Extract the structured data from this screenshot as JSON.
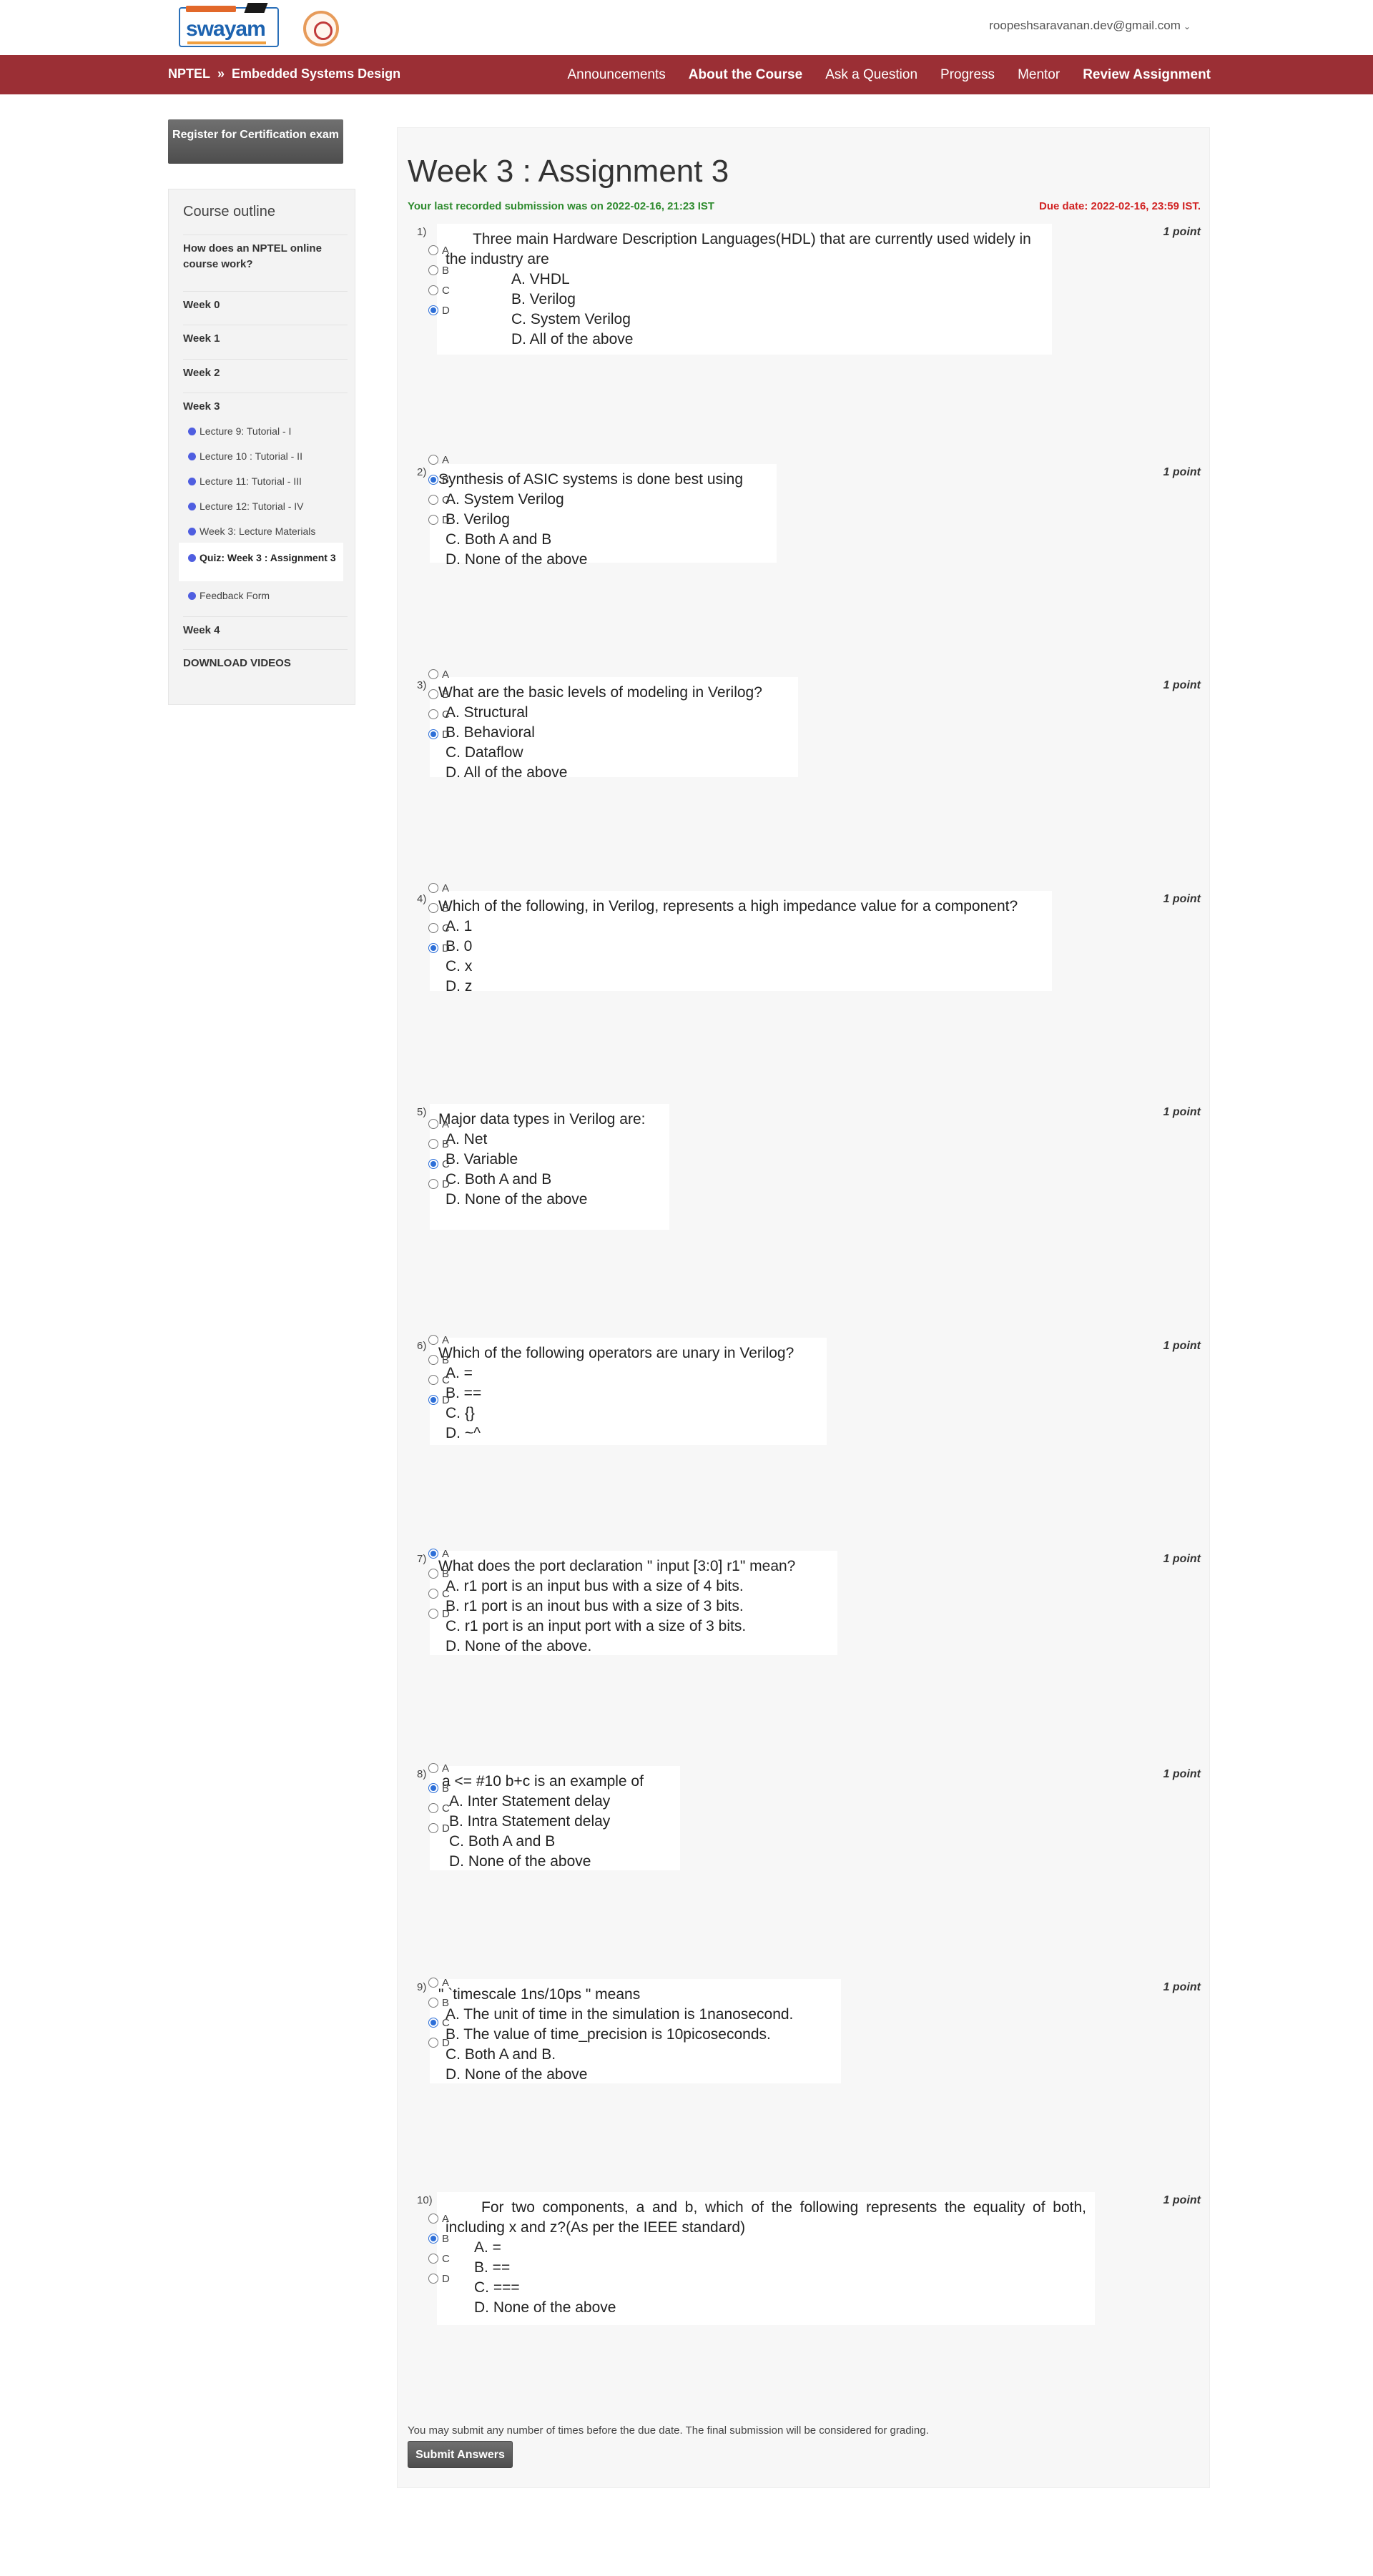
{
  "header": {
    "logo_text": "swayam",
    "user_email": "roopeshsaravanan.dev@gmail.com"
  },
  "nav": {
    "brand": "NPTEL",
    "separator": "»",
    "course": "Embedded Systems Design",
    "links": [
      "Announcements",
      "About the Course",
      "Ask a Question",
      "Progress",
      "Mentor",
      "Review Assignment"
    ]
  },
  "sidebar": {
    "register_button": "Register for Certification exam",
    "outline_title": "Course outline",
    "items": {
      "nptel": "How does an NPTEL online course work?",
      "week0": "Week 0",
      "week1": "Week 1",
      "week2": "Week 2",
      "week3": "Week 3",
      "l9": "Lecture 9: Tutorial - I",
      "l10": "Lecture 10 : Tutorial - II",
      "l11": "Lecture 11: Tutorial - III",
      "l12": "Lecture 12: Tutorial - IV",
      "w3mat": "Week 3: Lecture Materials",
      "quiz": "Quiz: Week 3 : Assignment 3",
      "feedback": "Feedback Form",
      "week4": "Week 4",
      "download": "DOWNLOAD VIDEOS"
    }
  },
  "assignment": {
    "title": "Week 3 : Assignment 3",
    "last_submission": "Your last recorded submission was on 2022-02-16, 21:23 IST",
    "due_date": "Due date: 2022-02-16, 23:59 IST.",
    "point_label": "1 point",
    "radio_labels": [
      "A",
      "B",
      "C",
      "D"
    ],
    "questions": [
      {
        "num": "1)",
        "stem": "Three main Hardware Description Languages(HDL) that are currently used widely in the industry are",
        "options": [
          "A.   VHDL",
          "B.   Verilog",
          "C.   System Verilog",
          "D.   All of the above"
        ],
        "selected": "D"
      },
      {
        "num": "2)",
        "stem": "Synthesis of ASIC systems is done best using",
        "options": [
          "A.   System Verilog",
          "B.   Verilog",
          "C.   Both A and B",
          "D.   None of the above"
        ],
        "selected": "B"
      },
      {
        "num": "3)",
        "stem": "What are the basic levels of modeling in Verilog?",
        "options": [
          "A.   Structural",
          "B.   Behavioral",
          "C.   Dataflow",
          "D.   All of the above"
        ],
        "selected": "D"
      },
      {
        "num": "4)",
        "stem": "Which of the following, in Verilog, represents a high impedance value for a component?",
        "options": [
          "A.   1",
          "B.   0",
          "C.   x",
          "D.   z"
        ],
        "selected": "D"
      },
      {
        "num": "5)",
        "stem": "Major data types in Verilog are:",
        "options": [
          "A.   Net",
          "B.   Variable",
          "C.   Both A and B",
          "D.   None of the above"
        ],
        "selected": "C"
      },
      {
        "num": "6)",
        "stem": "Which of the following operators are unary in Verilog?",
        "options": [
          "A.   =",
          "B.   ==",
          "C.   {}",
          "D.   ~^"
        ],
        "selected": "D"
      },
      {
        "num": "7)",
        "stem": "What does the port declaration \" input [3:0] r1\" mean?",
        "options": [
          "A.   r1 port is an input bus with a size of 4 bits.",
          "B.   r1 port is an inout bus with a size of 3 bits.",
          "C.   r1 port is an input port with a size of 3 bits.",
          "D.   None of the above."
        ],
        "selected": "A"
      },
      {
        "num": "8)",
        "stem": "a <= #10 b+c is an example of",
        "options": [
          "A.   Inter Statement delay",
          "B.   Intra Statement delay",
          "C.   Both A and B",
          "D.   None of the above"
        ],
        "selected": "B"
      },
      {
        "num": "9)",
        "stem": "\" `timescale 1ns/10ps \" means",
        "options": [
          "A.   The unit of time in the simulation is 1nanosecond.",
          "B.   The value of time_precision is 10picoseconds.",
          "C.   Both A and B.",
          "D.   None of the above"
        ],
        "selected": "C"
      },
      {
        "num": "10)",
        "stem": "For two components, a and b, which of the following represents the equality of both, including x and z?(As per the IEEE standard)",
        "options": [
          "A.   =",
          "B.   ==",
          "C.   ===",
          "D.   None of the above"
        ],
        "selected": "B"
      }
    ],
    "footer_note": "You may submit any number of times before the due date. The final submission will be considered for grading.",
    "submit_label": "Submit Answers"
  }
}
